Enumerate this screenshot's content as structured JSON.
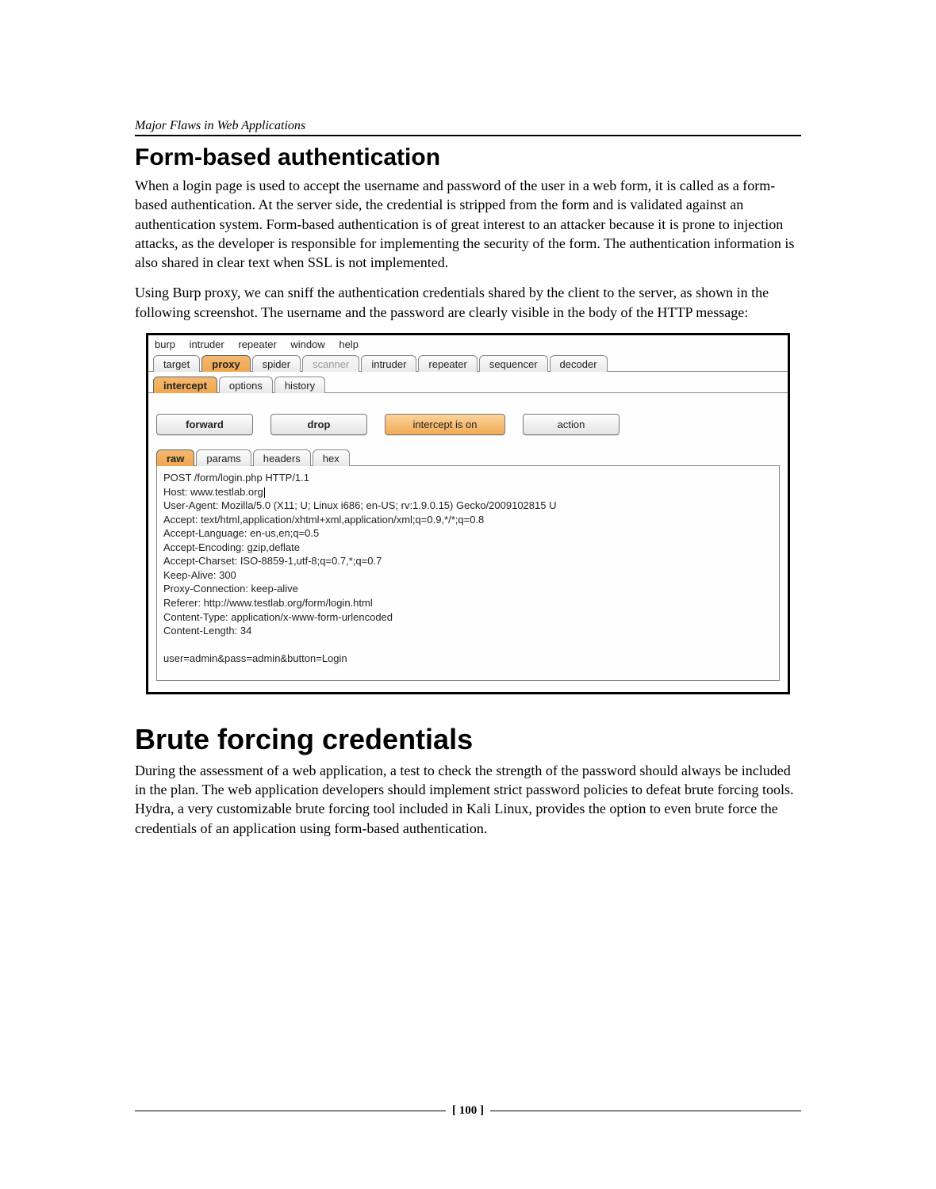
{
  "running_head": "Major Flaws in Web Applications",
  "section1_title": "Form-based authentication",
  "section1_para1": "When a login page is used to accept the username and password of the user in a web form, it is called as a form-based authentication. At the server side, the credential is stripped from the form and is validated against an authentication system. Form-based authentication is of great interest to an attacker because it is prone to injection attacks, as the developer is responsible for implementing the security of the form. The authentication information is also shared in clear text when SSL is not implemented.",
  "section1_para2": "Using Burp proxy, we can sniff the authentication credentials shared by the client to the server, as shown in the following screenshot. The username and the password are clearly visible in the body of the HTTP message:",
  "burp": {
    "menu": {
      "burp": "burp",
      "intruder": "intruder",
      "repeater": "repeater",
      "window": "window",
      "help": "help"
    },
    "tabs": {
      "target": "target",
      "proxy": "proxy",
      "spider": "spider",
      "scanner": "scanner",
      "intruder": "intruder",
      "repeater": "repeater",
      "sequencer": "sequencer",
      "decoder": "decoder"
    },
    "subtabs": {
      "intercept": "intercept",
      "options": "options",
      "history": "history"
    },
    "buttons": {
      "forward": "forward",
      "drop": "drop",
      "intercept": "intercept is on",
      "action": "action"
    },
    "viewtabs": {
      "raw": "raw",
      "params": "params",
      "headers": "headers",
      "hex": "hex"
    },
    "raw": {
      "l1": "POST /form/login.php HTTP/1.1",
      "l2": "Host: www.testlab.org",
      "l3": "User-Agent: Mozilla/5.0 (X11; U; Linux i686; en-US; rv:1.9.0.15) Gecko/2009102815 U",
      "l4": "Accept: text/html,application/xhtml+xml,application/xml;q=0.9,*/*;q=0.8",
      "l5": "Accept-Language: en-us,en;q=0.5",
      "l6": "Accept-Encoding: gzip,deflate",
      "l7": "Accept-Charset: ISO-8859-1,utf-8;q=0.7,*;q=0.7",
      "l8": "Keep-Alive: 300",
      "l9": "Proxy-Connection: keep-alive",
      "l10": "Referer: http://www.testlab.org/form/login.html",
      "l11": "Content-Type: application/x-www-form-urlencoded",
      "l12": "Content-Length: 34",
      "l13": "",
      "l14": "user=admin&pass=admin&button=Login"
    }
  },
  "section2_title": "Brute forcing credentials",
  "section2_para1": "During the assessment of a web application, a test to check the strength of the password should always be included in the plan. The web application developers should implement strict password policies to defeat brute forcing tools. Hydra, a very customizable brute forcing tool included in Kali Linux, provides the option to even brute force the credentials of an application using form-based authentication.",
  "page_number": "[ 100 ]"
}
